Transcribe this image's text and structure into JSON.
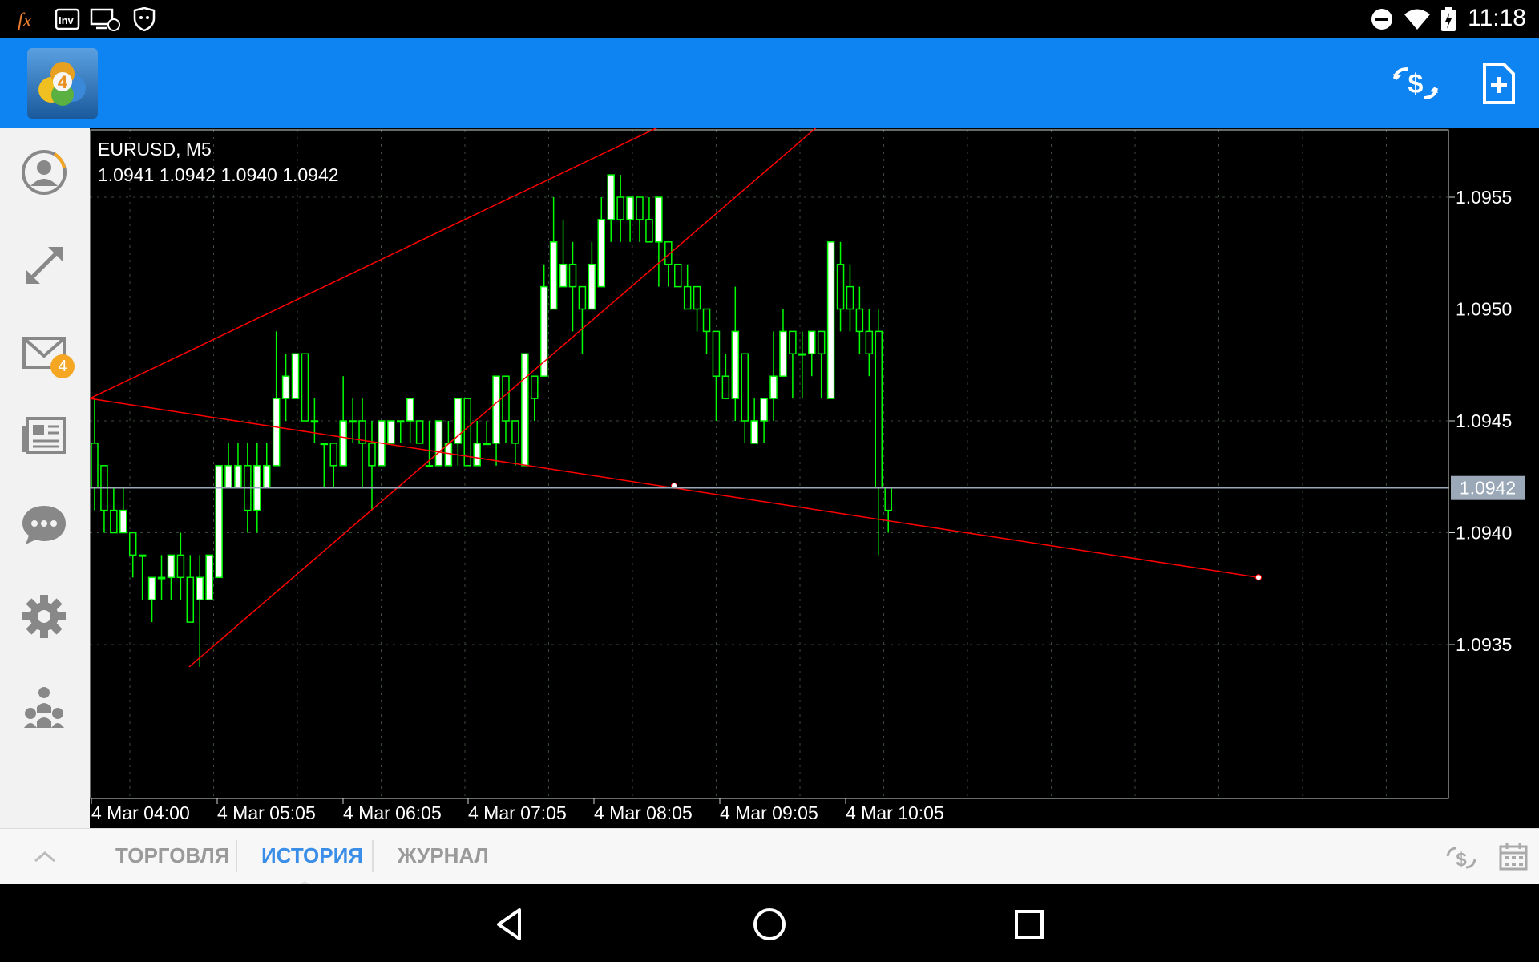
{
  "statusbar": {
    "time": "11:18",
    "icons": [
      "fx-icon",
      "inv-icon",
      "remote-desktop-icon",
      "shield-cat-icon",
      "do-not-disturb-icon",
      "wifi-icon",
      "battery-charging-icon"
    ]
  },
  "appbar": {
    "logo_badge": "4",
    "actions": [
      "trade-dollar-icon",
      "new-document-icon"
    ]
  },
  "sidebar": {
    "items": [
      {
        "name": "account-icon"
      },
      {
        "name": "trade-arrows-icon"
      },
      {
        "name": "mail-icon",
        "badge": "4"
      },
      {
        "name": "news-icon"
      },
      {
        "name": "chat-icon"
      },
      {
        "name": "settings-icon"
      },
      {
        "name": "community-icon"
      }
    ]
  },
  "chart": {
    "symbol_title": "EURUSD, M5",
    "ohlc_line": "1.0941 1.0942 1.0940 1.0942",
    "current_price_label": "1.0942",
    "colors": {
      "background": "#000000",
      "candle": "#00ff00",
      "candle_body": "#ffffff",
      "trendline": "#ff0000",
      "grid": "#2a3a2a",
      "bid_line": "#9aa8b8"
    }
  },
  "chart_data": {
    "type": "candlestick",
    "symbol": "EURUSD",
    "timeframe": "M5",
    "ylim": [
      1.093,
      1.096
    ],
    "yticks": [
      "1.0955",
      "1.0950",
      "1.0945",
      "1.0940",
      "1.0935"
    ],
    "xticks": [
      "4 Mar 04:00",
      "4 Mar 05:05",
      "4 Mar 06:05",
      "4 Mar 07:05",
      "4 Mar 08:05",
      "4 Mar 09:05",
      "4 Mar 10:05"
    ],
    "current_price": 1.0942,
    "candles": [
      [
        1.0944,
        1.0942,
        1.0946,
        1.0941
      ],
      [
        1.0943,
        1.0941,
        1.0943,
        1.094
      ],
      [
        1.0941,
        1.094,
        1.0942,
        1.094
      ],
      [
        1.094,
        1.0941,
        1.0942,
        1.094
      ],
      [
        1.094,
        1.0939,
        1.094,
        1.0938
      ],
      [
        1.0939,
        1.0939,
        1.0939,
        1.0937
      ],
      [
        1.0937,
        1.0938,
        1.0938,
        1.0936
      ],
      [
        1.0938,
        1.0938,
        1.0939,
        1.0937
      ],
      [
        1.0938,
        1.0939,
        1.0939,
        1.0937
      ],
      [
        1.0939,
        1.0938,
        1.094,
        1.0937
      ],
      [
        1.0938,
        1.0936,
        1.0939,
        1.0936
      ],
      [
        1.0937,
        1.0938,
        1.0939,
        1.0934
      ],
      [
        1.0937,
        1.0939,
        1.0939,
        1.0937
      ],
      [
        1.0938,
        1.0943,
        1.0943,
        1.0938
      ],
      [
        1.0942,
        1.0943,
        1.0944,
        1.0942
      ],
      [
        1.0942,
        1.0943,
        1.0944,
        1.0942
      ],
      [
        1.0943,
        1.0941,
        1.0944,
        1.094
      ],
      [
        1.0941,
        1.0943,
        1.0944,
        1.094
      ],
      [
        1.0942,
        1.0943,
        1.0944,
        1.0942
      ],
      [
        1.0943,
        1.0946,
        1.0949,
        1.0944
      ],
      [
        1.0946,
        1.0947,
        1.0948,
        1.0945
      ],
      [
        1.0946,
        1.0948,
        1.0948,
        1.0946
      ],
      [
        1.0948,
        1.0945,
        1.0948,
        1.0945
      ],
      [
        1.0945,
        1.0945,
        1.0946,
        1.0944
      ],
      [
        1.0944,
        1.0944,
        1.0944,
        1.0942
      ],
      [
        1.0944,
        1.0943,
        1.0944,
        1.0942
      ],
      [
        1.0943,
        1.0945,
        1.0947,
        1.0943
      ],
      [
        1.0945,
        1.0945,
        1.0946,
        1.0944
      ],
      [
        1.0945,
        1.0944,
        1.0946,
        1.0942
      ],
      [
        1.0944,
        1.0943,
        1.0945,
        1.0941
      ],
      [
        1.0943,
        1.0945,
        1.0945,
        1.0943
      ],
      [
        1.0944,
        1.0945,
        1.0945,
        1.0944
      ],
      [
        1.0945,
        1.0945,
        1.0945,
        1.0944
      ],
      [
        1.0945,
        1.0946,
        1.0946,
        1.0944
      ],
      [
        1.0945,
        1.0944,
        1.0945,
        1.0944
      ],
      [
        1.0943,
        1.0943,
        1.0945,
        1.0943
      ],
      [
        1.0943,
        1.0945,
        1.0945,
        1.0943
      ],
      [
        1.0943,
        1.0944,
        1.0945,
        1.0943
      ],
      [
        1.0944,
        1.0946,
        1.0946,
        1.0943
      ],
      [
        1.0946,
        1.0943,
        1.0946,
        1.0943
      ],
      [
        1.0943,
        1.0944,
        1.0945,
        1.0943
      ],
      [
        1.0944,
        1.0944,
        1.0945,
        1.0944
      ],
      [
        1.0944,
        1.0947,
        1.0947,
        1.0943
      ],
      [
        1.0947,
        1.0945,
        1.0947,
        1.0944
      ],
      [
        1.0945,
        1.0944,
        1.0945,
        1.0943
      ],
      [
        1.0943,
        1.0948,
        1.0948,
        1.0943
      ],
      [
        1.0947,
        1.0946,
        1.0947,
        1.0945
      ],
      [
        1.0947,
        1.0951,
        1.0952,
        1.0947
      ],
      [
        1.095,
        1.0953,
        1.0955,
        1.095
      ],
      [
        1.0951,
        1.0952,
        1.0954,
        1.0951
      ],
      [
        1.0952,
        1.0951,
        1.0953,
        1.0949
      ],
      [
        1.0951,
        1.095,
        1.0951,
        1.0948
      ],
      [
        1.095,
        1.0952,
        1.0953,
        1.095
      ],
      [
        1.0951,
        1.0954,
        1.0955,
        1.0951
      ],
      [
        1.0954,
        1.0956,
        1.0956,
        1.0953
      ],
      [
        1.0955,
        1.0954,
        1.0956,
        1.0953
      ],
      [
        1.0954,
        1.0955,
        1.0955,
        1.0953
      ],
      [
        1.0955,
        1.0954,
        1.0955,
        1.0953
      ],
      [
        1.0954,
        1.0953,
        1.0955,
        1.0953
      ],
      [
        1.0953,
        1.0955,
        1.0955,
        1.0951
      ],
      [
        1.0953,
        1.0952,
        1.0953,
        1.0951
      ],
      [
        1.0952,
        1.0951,
        1.0952,
        1.0951
      ],
      [
        1.0951,
        1.095,
        1.0952,
        1.095
      ],
      [
        1.0951,
        1.095,
        1.0951,
        1.0949
      ],
      [
        1.095,
        1.0949,
        1.095,
        1.0948
      ],
      [
        1.0949,
        1.0947,
        1.0949,
        1.0945
      ],
      [
        1.0947,
        1.0946,
        1.0948,
        1.0946
      ],
      [
        1.0946,
        1.0949,
        1.0951,
        1.0945
      ],
      [
        1.0948,
        1.0945,
        1.0948,
        1.0944
      ],
      [
        1.0944,
        1.0945,
        1.0946,
        1.0944
      ],
      [
        1.0945,
        1.0946,
        1.0946,
        1.0944
      ],
      [
        1.0946,
        1.0947,
        1.0949,
        1.0945
      ],
      [
        1.0947,
        1.0949,
        1.095,
        1.0947
      ],
      [
        1.0949,
        1.0948,
        1.0949,
        1.0946
      ],
      [
        1.0948,
        1.0948,
        1.0949,
        1.0946
      ],
      [
        1.0948,
        1.0949,
        1.0949,
        1.0947
      ],
      [
        1.0949,
        1.0948,
        1.0949,
        1.0946
      ],
      [
        1.0946,
        1.0953,
        1.0953,
        1.0946
      ],
      [
        1.0952,
        1.095,
        1.0953,
        1.0949
      ],
      [
        1.0951,
        1.095,
        1.0952,
        1.0949
      ],
      [
        1.095,
        1.0949,
        1.0951,
        1.0948
      ],
      [
        1.0949,
        1.0948,
        1.095,
        1.0947
      ],
      [
        1.0949,
        1.0942,
        1.095,
        1.0939
      ],
      [
        1.0942,
        1.0941,
        1.0942,
        1.094
      ]
    ],
    "trendlines": [
      {
        "from": [
          "4 Mar 03:55",
          1.0946
        ],
        "to": [
          "4 Mar 11:55",
          1.0963
        ]
      },
      {
        "from": [
          "4 Mar 04:20",
          1.0934
        ],
        "to": [
          "4 Mar 11:30",
          1.0962
        ]
      },
      {
        "from": [
          "4 Mar 03:55",
          1.0946
        ],
        "to": [
          "4 Mar 12:00",
          1.0938
        ]
      }
    ]
  },
  "bottombar": {
    "tabs": [
      {
        "label": "ТОРГОВЛЯ"
      },
      {
        "label": "ИСТОРИЯ"
      },
      {
        "label": "ЖУРНАЛ"
      }
    ],
    "active_tab": 1
  }
}
